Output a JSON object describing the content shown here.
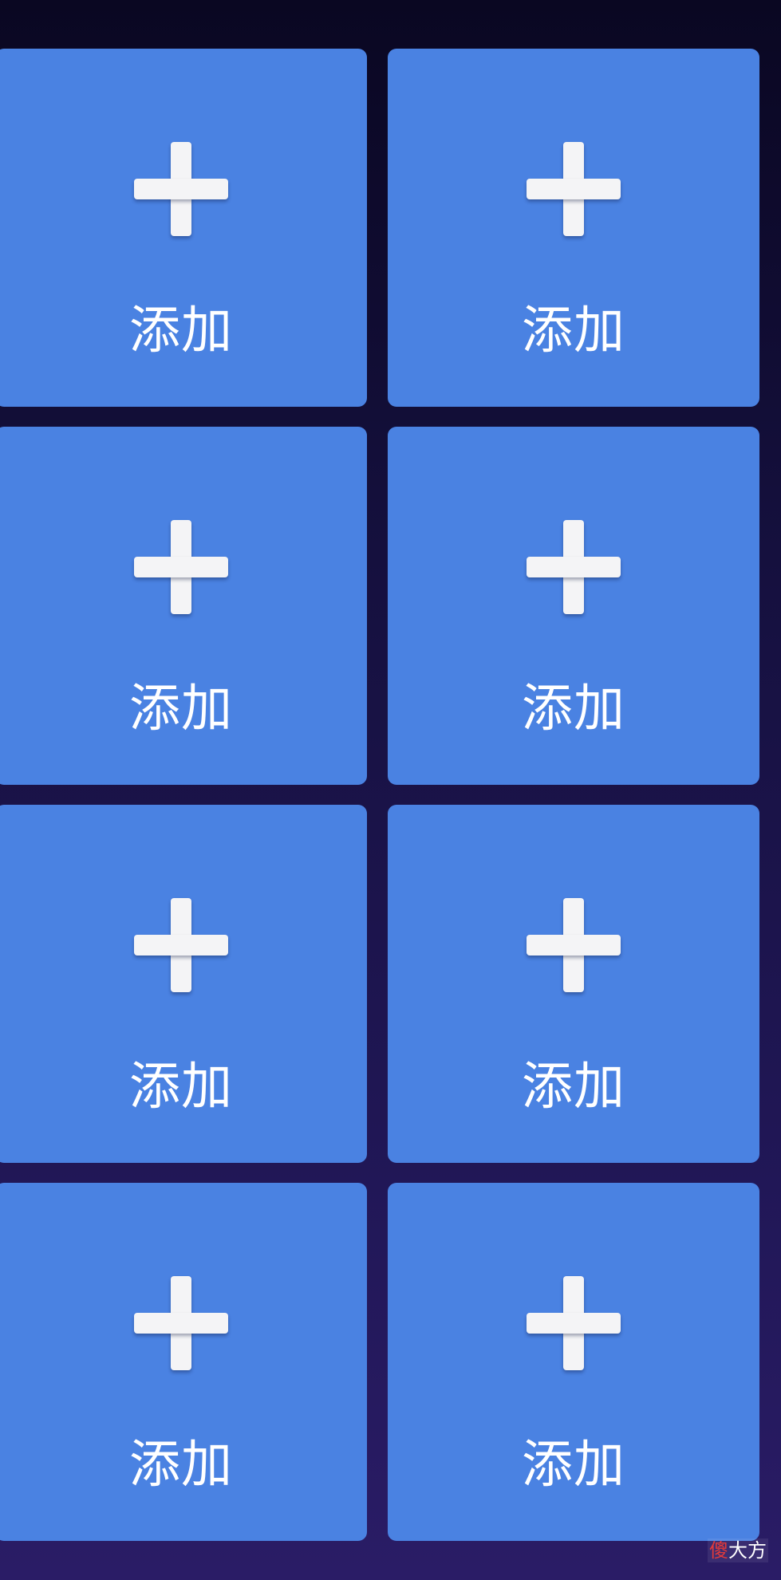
{
  "tiles": [
    {
      "label": "添加",
      "icon": "plus-icon"
    },
    {
      "label": "添加",
      "icon": "plus-icon"
    },
    {
      "label": "添加",
      "icon": "plus-icon"
    },
    {
      "label": "添加",
      "icon": "plus-icon"
    },
    {
      "label": "添加",
      "icon": "plus-icon"
    },
    {
      "label": "添加",
      "icon": "plus-icon"
    },
    {
      "label": "添加",
      "icon": "plus-icon"
    },
    {
      "label": "添加",
      "icon": "plus-icon"
    }
  ],
  "watermark": {
    "first": "傻",
    "rest": "大方"
  },
  "colors": {
    "tile": "#4a82e2",
    "icon": "#f4f4f6",
    "background_top": "#0a0722",
    "background_bottom": "#2a1c66"
  }
}
